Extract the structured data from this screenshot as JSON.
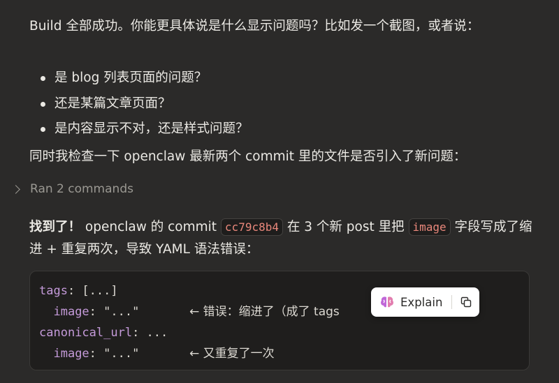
{
  "message": {
    "para1": "Build 全部成功。你能更具体说是什么显示问题吗？比如发一个截图，或者说：",
    "bullets": [
      "是 blog 列表页面的问题？",
      "还是某篇文章页面？",
      "是内容显示不对，还是样式问题？"
    ],
    "para2": "同时我检查一下 openclaw 最新两个 commit 里的文件是否引入了新问题：",
    "ran_label": "Ran 2 commands",
    "found_bold": "找到了！",
    "found_text_a": " openclaw 的 commit ",
    "commit_hash": "cc79c8b4",
    "found_text_b": " 在 3 个新 post 里把 ",
    "field_name": "image",
    "found_text_c": " 字段写成了缩进 + 重复两次，导致 YAML 语法错误："
  },
  "code": {
    "line1_key": "tags",
    "line1_rest": ": [...]",
    "line2_key": "image",
    "line2_rest": ": \"...\"",
    "line2_comment": "← 错误：缩进了（成了 tags",
    "line3_key": "canonical_url",
    "line3_rest": ": ...",
    "line4_key": "image",
    "line4_rest": ": \"...\"",
    "line4_comment": "← 又重复了一次"
  },
  "popup": {
    "explain_label": "Explain",
    "icons": [
      "brain-icon",
      "copy-icon"
    ]
  },
  "colors": {
    "background": "#2b2a29",
    "code_bg": "#1f1e1d",
    "inline_code": "#e9877b",
    "yaml_key": "#c49ad9"
  }
}
